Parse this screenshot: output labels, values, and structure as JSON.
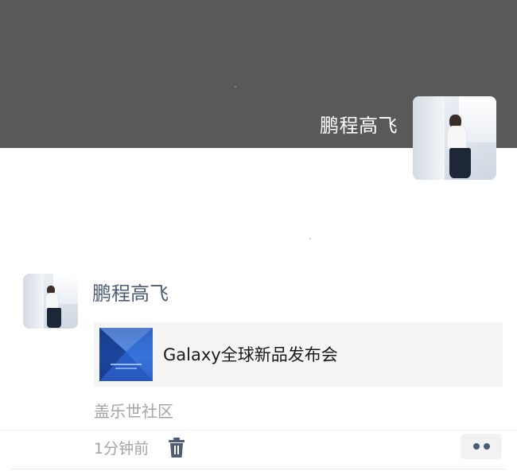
{
  "profile": {
    "name": "鹏程高飞",
    "cover_color": "#595959"
  },
  "post": {
    "author": "鹏程高飞",
    "link": {
      "title": "Galaxy全球新品发布会",
      "thumbnail_icon": "galaxy-event-thumbnail"
    },
    "source": "盖乐世社区",
    "time": "1分钟前",
    "actions": {
      "delete_icon": "trash-icon",
      "more_icon": "more-dots-icon"
    }
  },
  "colors": {
    "name_blue": "#4d5b76",
    "meta_gray": "#a4a4a4",
    "card_bg": "#f5f5f5"
  }
}
